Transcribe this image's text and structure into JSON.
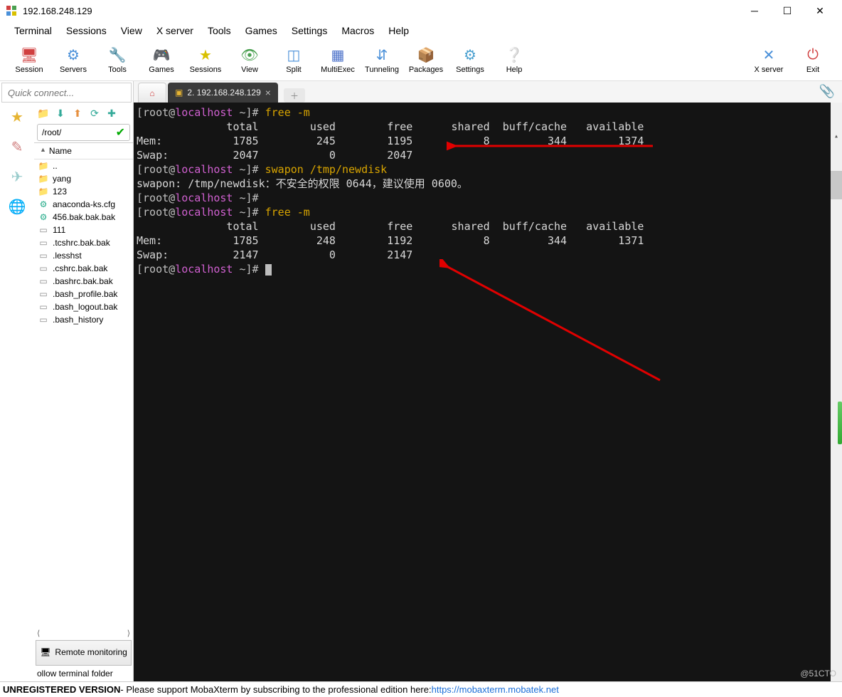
{
  "window": {
    "title": "192.168.248.129"
  },
  "menu": [
    "Terminal",
    "Sessions",
    "View",
    "X server",
    "Tools",
    "Games",
    "Settings",
    "Macros",
    "Help"
  ],
  "toolbar": [
    {
      "label": "Session",
      "color": "#d04040"
    },
    {
      "label": "Servers",
      "color": "#4a90d9"
    },
    {
      "label": "Tools",
      "color": "#d08400"
    },
    {
      "label": "Games",
      "color": "#888"
    },
    {
      "label": "Sessions",
      "color": "#d8c000"
    },
    {
      "label": "View",
      "color": "#4aa050"
    },
    {
      "label": "Split",
      "color": "#4a90d9"
    },
    {
      "label": "MultiExec",
      "color": "#4a70c9"
    },
    {
      "label": "Tunneling",
      "color": "#4a90d9"
    },
    {
      "label": "Packages",
      "color": "#d08400"
    },
    {
      "label": "Settings",
      "color": "#4aa0d0"
    },
    {
      "label": "Help",
      "color": "#2a80d0"
    }
  ],
  "toolbar_right": [
    {
      "label": "X server"
    },
    {
      "label": "Exit"
    }
  ],
  "quick_connect_placeholder": "Quick connect...",
  "path": "/root/",
  "file_header": "Name",
  "files": [
    {
      "name": "..",
      "type": "up"
    },
    {
      "name": "yang",
      "type": "folder"
    },
    {
      "name": "123",
      "type": "folder"
    },
    {
      "name": "anaconda-ks.cfg",
      "type": "gear"
    },
    {
      "name": "456.bak.bak.bak",
      "type": "gear"
    },
    {
      "name": "111",
      "type": "file"
    },
    {
      "name": ".tcshrc.bak.bak",
      "type": "file"
    },
    {
      "name": ".lesshst",
      "type": "file"
    },
    {
      "name": ".cshrc.bak.bak",
      "type": "file"
    },
    {
      "name": ".bashrc.bak.bak",
      "type": "file"
    },
    {
      "name": ".bash_profile.bak",
      "type": "file"
    },
    {
      "name": ".bash_logout.bak",
      "type": "file"
    },
    {
      "name": ".bash_history",
      "type": "file"
    }
  ],
  "remote_monitoring": "Remote monitoring",
  "follow": "ollow terminal folder",
  "tabs": {
    "active_label": "2. 192.168.248.129"
  },
  "terminal": {
    "lines": [
      {
        "t": "prompt",
        "cmd": "free -m"
      },
      {
        "t": "hdr",
        "text": "              total        used        free      shared  buff/cache   available"
      },
      {
        "t": "row",
        "text": "Mem:           1785         245        1195           8         344        1374"
      },
      {
        "t": "row",
        "text": "Swap:          2047           0        2047"
      },
      {
        "t": "prompt",
        "cmd": "swapon /tmp/newdisk"
      },
      {
        "t": "row",
        "text": "swapon: /tmp/newdisk：不安全的权限 0644，建议使用 0600。"
      },
      {
        "t": "prompt",
        "cmd": ""
      },
      {
        "t": "prompt",
        "cmd": "free -m"
      },
      {
        "t": "hdr",
        "text": "              total        used        free      shared  buff/cache   available"
      },
      {
        "t": "row",
        "text": "Mem:           1785         248        1192           8         344        1371"
      },
      {
        "t": "row",
        "text": "Swap:          2147           0        2147"
      },
      {
        "t": "prompt",
        "cmd": "",
        "cursor": true
      }
    ],
    "prompt_user": "root",
    "prompt_host": "localhost",
    "prompt_path": "~"
  },
  "status": {
    "bold": "UNREGISTERED VERSION",
    "text": "  -  Please support MobaXterm by subscribing to the professional edition here:  ",
    "link": "https://mobaxterm.mobatek.net"
  },
  "watermark": "@51CTO"
}
